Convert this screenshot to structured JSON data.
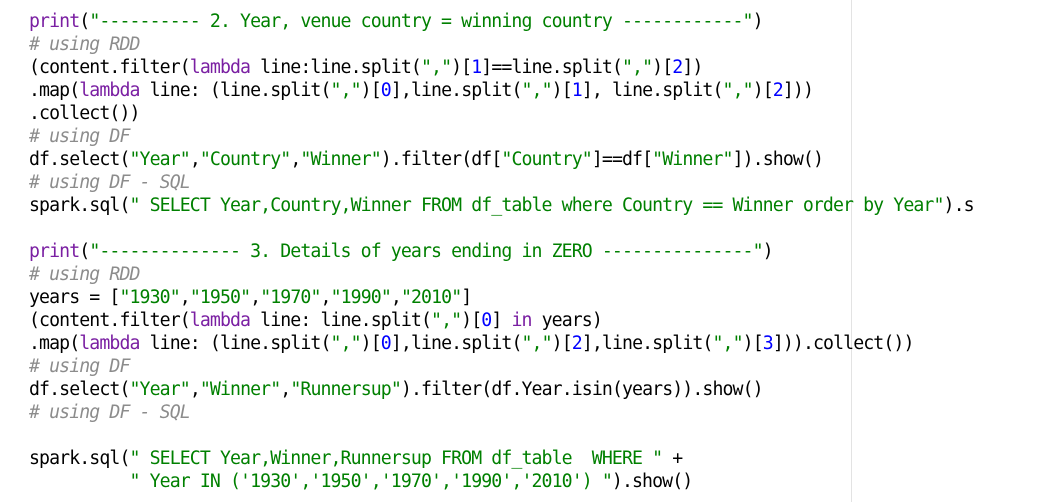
{
  "editor": {
    "colors": {
      "keyword": "#7a1fa2",
      "string": "#008000",
      "number": "#0000ff",
      "comment": "#8c8c8c",
      "text": "#000000"
    },
    "lines": [
      [
        {
          "t": "kw",
          "v": "print"
        },
        {
          "t": "p",
          "v": "("
        },
        {
          "t": "str",
          "v": "\"---------- 2. Year, venue country = winning country ------------\""
        },
        {
          "t": "p",
          "v": ")"
        }
      ],
      [
        {
          "t": "cmt",
          "v": "# using RDD"
        }
      ],
      [
        {
          "t": "p",
          "v": "(content.filter("
        },
        {
          "t": "kw",
          "v": "lambda"
        },
        {
          "t": "p",
          "v": " line:line.split("
        },
        {
          "t": "str",
          "v": "\",\""
        },
        {
          "t": "p",
          "v": ")["
        },
        {
          "t": "num",
          "v": "1"
        },
        {
          "t": "p",
          "v": "]==line.split("
        },
        {
          "t": "str",
          "v": "\",\""
        },
        {
          "t": "p",
          "v": ")["
        },
        {
          "t": "num",
          "v": "2"
        },
        {
          "t": "p",
          "v": "])"
        }
      ],
      [
        {
          "t": "p",
          "v": ".map("
        },
        {
          "t": "kw",
          "v": "lambda"
        },
        {
          "t": "p",
          "v": " line: (line.split("
        },
        {
          "t": "str",
          "v": "\",\""
        },
        {
          "t": "p",
          "v": ")["
        },
        {
          "t": "num",
          "v": "0"
        },
        {
          "t": "p",
          "v": "],line.split("
        },
        {
          "t": "str",
          "v": "\",\""
        },
        {
          "t": "p",
          "v": ")["
        },
        {
          "t": "num",
          "v": "1"
        },
        {
          "t": "p",
          "v": "], line.split("
        },
        {
          "t": "str",
          "v": "\",\""
        },
        {
          "t": "p",
          "v": ")["
        },
        {
          "t": "num",
          "v": "2"
        },
        {
          "t": "p",
          "v": "]))"
        }
      ],
      [
        {
          "t": "p",
          "v": ".collect())"
        }
      ],
      [
        {
          "t": "cmt",
          "v": "# using DF"
        }
      ],
      [
        {
          "t": "p",
          "v": "df.select("
        },
        {
          "t": "str",
          "v": "\"Year\""
        },
        {
          "t": "p",
          "v": ","
        },
        {
          "t": "str",
          "v": "\"Country\""
        },
        {
          "t": "p",
          "v": ","
        },
        {
          "t": "str",
          "v": "\"Winner\""
        },
        {
          "t": "p",
          "v": ").filter(df["
        },
        {
          "t": "str",
          "v": "\"Country\""
        },
        {
          "t": "p",
          "v": "]==df["
        },
        {
          "t": "str",
          "v": "\"Winner\""
        },
        {
          "t": "p",
          "v": "]).show()"
        }
      ],
      [
        {
          "t": "cmt",
          "v": "# using DF - SQL"
        }
      ],
      [
        {
          "t": "p",
          "v": "spark.sql("
        },
        {
          "t": "str",
          "v": "\" SELECT Year,Country,Winner FROM df_table where Country == Winner order by Year\""
        },
        {
          "t": "p",
          "v": ").s"
        }
      ],
      [],
      [
        {
          "t": "kw",
          "v": "print"
        },
        {
          "t": "p",
          "v": "("
        },
        {
          "t": "str",
          "v": "\"-------------- 3. Details of years ending in ZERO ---------------\""
        },
        {
          "t": "p",
          "v": ")"
        }
      ],
      [
        {
          "t": "cmt",
          "v": "# using RDD"
        }
      ],
      [
        {
          "t": "p",
          "v": "years = ["
        },
        {
          "t": "str",
          "v": "\"1930\""
        },
        {
          "t": "p",
          "v": ","
        },
        {
          "t": "str",
          "v": "\"1950\""
        },
        {
          "t": "p",
          "v": ","
        },
        {
          "t": "str",
          "v": "\"1970\""
        },
        {
          "t": "p",
          "v": ","
        },
        {
          "t": "str",
          "v": "\"1990\""
        },
        {
          "t": "p",
          "v": ","
        },
        {
          "t": "str",
          "v": "\"2010\""
        },
        {
          "t": "p",
          "v": "]"
        }
      ],
      [
        {
          "t": "p",
          "v": "(content.filter("
        },
        {
          "t": "kw",
          "v": "lambda"
        },
        {
          "t": "p",
          "v": " line: line.split("
        },
        {
          "t": "str",
          "v": "\",\""
        },
        {
          "t": "p",
          "v": ")["
        },
        {
          "t": "num",
          "v": "0"
        },
        {
          "t": "p",
          "v": "] "
        },
        {
          "t": "kw",
          "v": "in"
        },
        {
          "t": "p",
          "v": " years)"
        }
      ],
      [
        {
          "t": "p",
          "v": ".map("
        },
        {
          "t": "kw",
          "v": "lambda"
        },
        {
          "t": "p",
          "v": " line: (line.split("
        },
        {
          "t": "str",
          "v": "\",\""
        },
        {
          "t": "p",
          "v": ")["
        },
        {
          "t": "num",
          "v": "0"
        },
        {
          "t": "p",
          "v": "],line.split("
        },
        {
          "t": "str",
          "v": "\",\""
        },
        {
          "t": "p",
          "v": ")["
        },
        {
          "t": "num",
          "v": "2"
        },
        {
          "t": "p",
          "v": "],line.split("
        },
        {
          "t": "str",
          "v": "\",\""
        },
        {
          "t": "p",
          "v": ")["
        },
        {
          "t": "num",
          "v": "3"
        },
        {
          "t": "p",
          "v": "])).collect())"
        }
      ],
      [
        {
          "t": "cmt",
          "v": "# using DF"
        }
      ],
      [
        {
          "t": "p",
          "v": "df.select("
        },
        {
          "t": "str",
          "v": "\"Year\""
        },
        {
          "t": "p",
          "v": ","
        },
        {
          "t": "str",
          "v": "\"Winner\""
        },
        {
          "t": "p",
          "v": ","
        },
        {
          "t": "str",
          "v": "\"Runnersup\""
        },
        {
          "t": "p",
          "v": ").filter(df.Year.isin(years)).show()"
        }
      ],
      [
        {
          "t": "cmt",
          "v": "# using DF - SQL"
        }
      ],
      [],
      [
        {
          "t": "p",
          "v": "spark.sql("
        },
        {
          "t": "str",
          "v": "\" SELECT Year,Winner,Runnersup FROM df_table  WHERE \""
        },
        {
          "t": "p",
          "v": " +"
        }
      ],
      [
        {
          "t": "p",
          "v": "          "
        },
        {
          "t": "str",
          "v": "\" Year IN ('1930','1950','1970','1990','2010') \""
        },
        {
          "t": "p",
          "v": ").show()"
        }
      ]
    ]
  }
}
